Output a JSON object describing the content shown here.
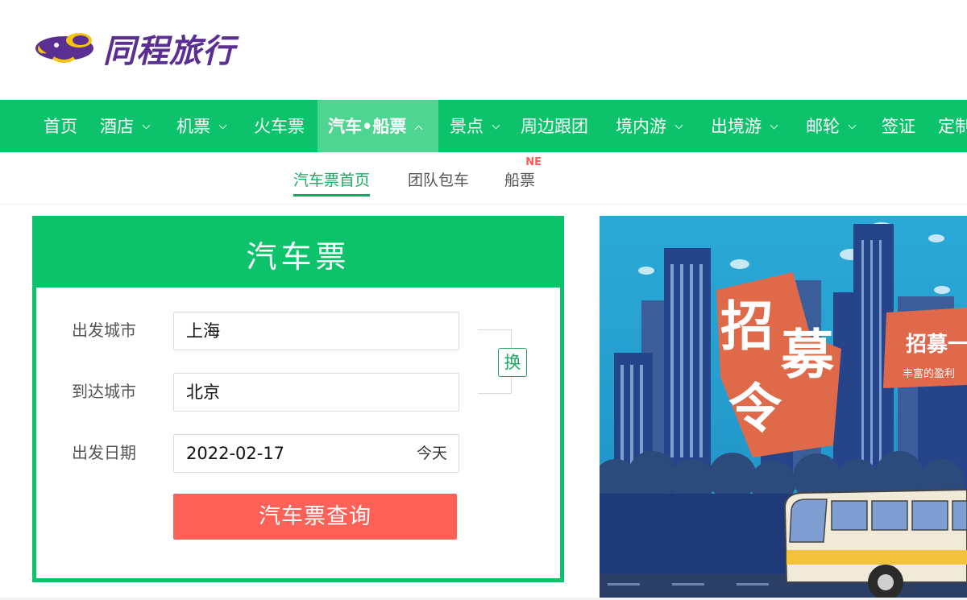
{
  "brand": {
    "name": "同程旅行"
  },
  "nav": {
    "items": [
      {
        "label": "首页",
        "dropdown": false
      },
      {
        "label": "酒店",
        "dropdown": true
      },
      {
        "label": "机票",
        "dropdown": true
      },
      {
        "label": "火车票",
        "dropdown": false
      },
      {
        "label": "汽车•船票",
        "dropdown": true,
        "active": true
      },
      {
        "label": "景点",
        "dropdown": true
      },
      {
        "label": "周边跟团",
        "dropdown": false
      },
      {
        "label": "境内游",
        "dropdown": true
      },
      {
        "label": "出境游",
        "dropdown": true
      },
      {
        "label": "邮轮",
        "dropdown": true
      },
      {
        "label": "签证",
        "dropdown": false
      },
      {
        "label": "定制",
        "dropdown": false
      }
    ]
  },
  "subnav": {
    "items": [
      {
        "label": "汽车票首页",
        "active": true
      },
      {
        "label": "团队包车"
      },
      {
        "label": "船票",
        "badge": "NE"
      }
    ]
  },
  "search": {
    "title": "汽车票",
    "depart_label": "出发城市",
    "depart_value": "上海",
    "arrive_label": "到达城市",
    "arrive_value": "北京",
    "date_label": "出发日期",
    "date_value": "2022-02-17",
    "date_hint": "今天",
    "swap_label": "换",
    "submit_label": "汽车票查询"
  },
  "banner": {
    "headline_chars": [
      "招",
      "募",
      "令"
    ],
    "tag_title": "招募一",
    "tag_sub": "丰富的盈利"
  },
  "colors": {
    "nav_green": "#0cc36b",
    "nav_active": "#4fd592",
    "accent_green": "#1aa862",
    "search_button": "#fd6158",
    "brand_purple": "#5b2e91",
    "brand_yellow": "#f5c40f"
  }
}
